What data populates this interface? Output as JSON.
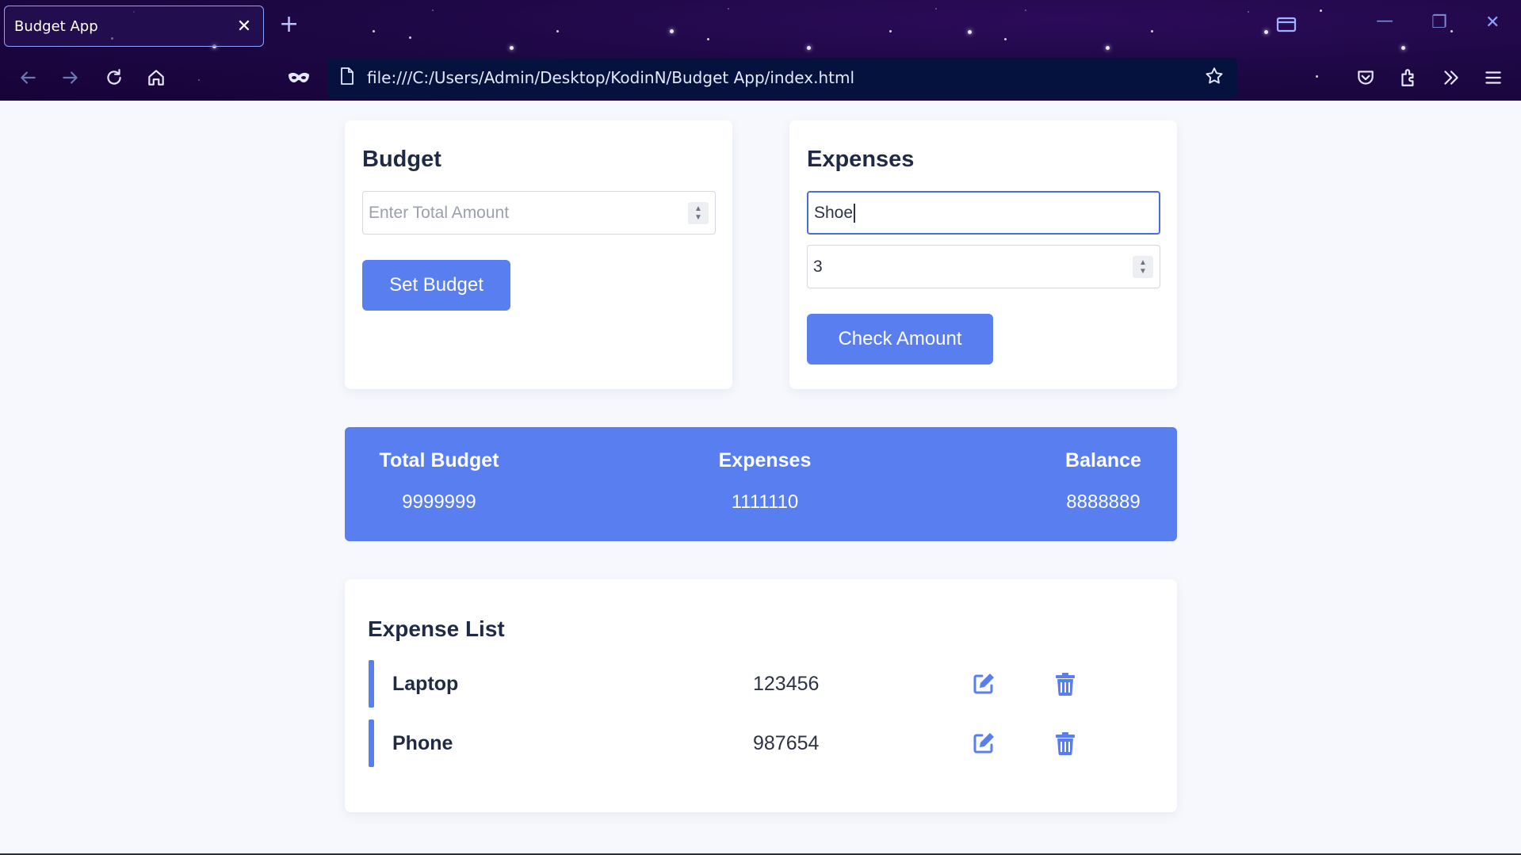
{
  "browser": {
    "tab_title": "Budget App",
    "tab_close_icon": "close-icon",
    "new_tab_symbol": "+",
    "url": "file:///C:/Users/Admin/Desktop/KodinN/Budget App/index.html",
    "window_controls": {
      "minimize": "—",
      "restore": "❐",
      "close": "✕"
    }
  },
  "budget_card": {
    "title": "Budget",
    "input_placeholder": "Enter Total Amount",
    "input_value": "",
    "button_label": "Set Budget"
  },
  "expenses_card": {
    "title": "Expenses",
    "name_value": "Shoe",
    "amount_value": "3",
    "button_label": "Check Amount"
  },
  "summary": {
    "total_budget_label": "Total Budget",
    "total_budget_value": "9999999",
    "expenses_label": "Expenses",
    "expenses_value": "1111110",
    "balance_label": "Balance",
    "balance_value": "8888889"
  },
  "expense_list": {
    "title": "Expense List",
    "items": [
      {
        "name": "Laptop",
        "amount": "123456"
      },
      {
        "name": "Phone",
        "amount": "987654"
      }
    ]
  },
  "colors": {
    "accent": "#587ef0",
    "chrome_bg": "#1e0845",
    "urlbar_bg": "#05123d",
    "text_dark": "#1f2a44"
  }
}
